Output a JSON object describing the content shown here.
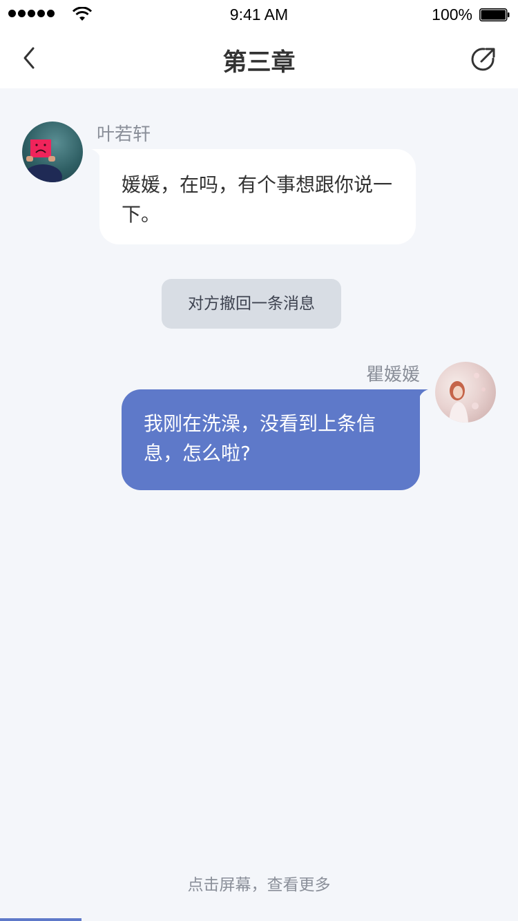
{
  "status_bar": {
    "time": "9:41 AM",
    "battery": "100%"
  },
  "nav": {
    "title": "第三章",
    "back_icon": "chevron-left-icon",
    "share_icon": "share-external-icon"
  },
  "messages": [
    {
      "sender": "叶若轩",
      "side": "left",
      "text": "媛媛，在吗，有个事想跟你说一下。"
    },
    {
      "sender": "瞿媛媛",
      "side": "right",
      "text": "我刚在洗澡，没看到上条信息，怎么啦?"
    }
  ],
  "system_notice": "对方撤回一条消息",
  "footer": {
    "hint": "点击屏幕，查看更多",
    "progress": 0.157
  },
  "colors": {
    "accent": "#5e79c9",
    "background": "#f4f6fa",
    "notice_bg": "#d8dde4"
  }
}
